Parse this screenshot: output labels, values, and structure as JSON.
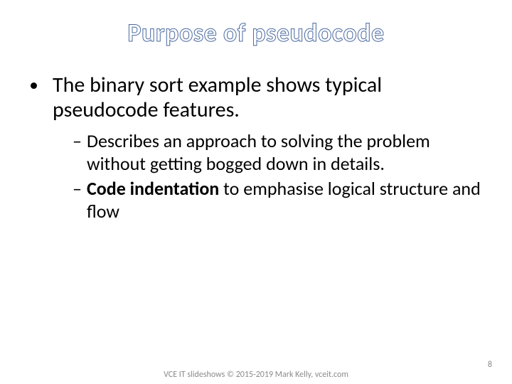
{
  "title": "Purpose of pseudocode",
  "bullets": {
    "main": "The binary sort example shows typical pseudocode features.",
    "sub1": "Describes an approach to solving the problem without getting bogged down in details.",
    "sub2_bold": "Code indentation",
    "sub2_rest": " to emphasise logical structure and flow"
  },
  "footer": {
    "center": "VCE IT slideshows © 2015-2019 Mark Kelly, vceit.com",
    "page": "8"
  }
}
